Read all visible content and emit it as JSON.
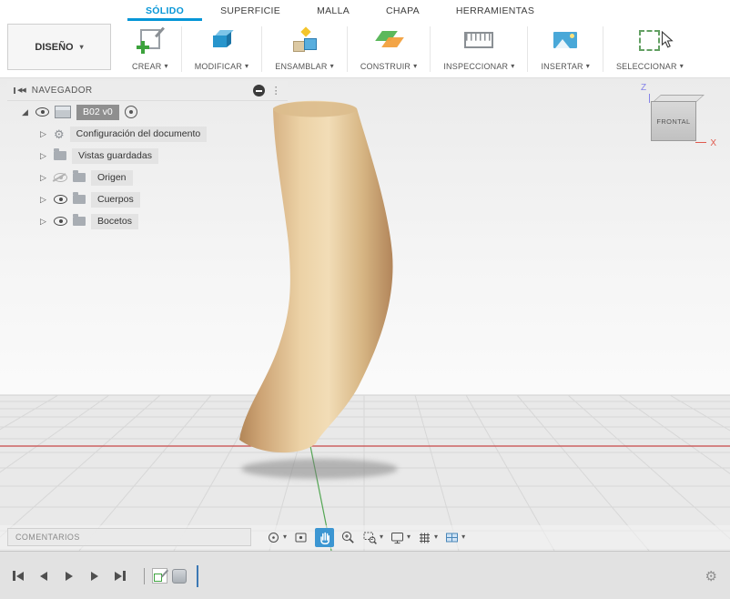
{
  "ribbon": {
    "workspace_button": "DISEÑO",
    "tabs": [
      {
        "label": "SÓLIDO",
        "active": true
      },
      {
        "label": "SUPERFICIE",
        "active": false
      },
      {
        "label": "MALLA",
        "active": false
      },
      {
        "label": "CHAPA",
        "active": false
      },
      {
        "label": "HERRAMIENTAS",
        "active": false
      }
    ],
    "groups": [
      {
        "label": "CREAR"
      },
      {
        "label": "MODIFICAR"
      },
      {
        "label": "ENSAMBLAR"
      },
      {
        "label": "CONSTRUIR"
      },
      {
        "label": "INSPECCIONAR"
      },
      {
        "label": "INSERTAR"
      },
      {
        "label": "SELECCIONAR"
      }
    ]
  },
  "navigator": {
    "title": "NAVEGADOR",
    "root_label": "B02 v0",
    "items": [
      {
        "label": "Configuración del documento"
      },
      {
        "label": "Vistas guardadas"
      },
      {
        "label": "Origen"
      },
      {
        "label": "Cuerpos"
      },
      {
        "label": "Bocetos"
      }
    ]
  },
  "viewcube": {
    "face": "FRONTAL",
    "axis_z": "Z",
    "axis_x": "X"
  },
  "bottom_bar": {
    "comments_label": "COMENTARIOS"
  },
  "icons": {
    "caret": "▾",
    "gear": "⚙",
    "kebab": "⋮",
    "dock": "◀◀",
    "expanded": "◢",
    "collapsed": "▷"
  },
  "colors": {
    "accent": "#0696d7",
    "model_tan": "#e9d2a6",
    "axis_x_red": "#c84848",
    "axis_y_green": "#53a653",
    "active_tool_blue": "#3c96d2"
  }
}
